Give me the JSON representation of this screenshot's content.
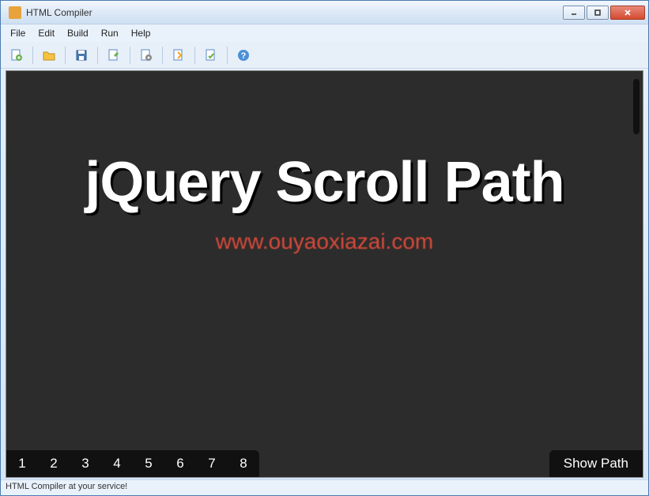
{
  "window": {
    "title": "HTML Compiler"
  },
  "menu": {
    "file": "File",
    "edit": "Edit",
    "build": "Build",
    "run": "Run",
    "help": "Help"
  },
  "toolbar": {
    "icons": [
      "new-file",
      "open-folder",
      "save",
      "edit-doc",
      "settings-doc",
      "export",
      "check-doc",
      "help"
    ]
  },
  "content": {
    "headline": "jQuery Scroll Path",
    "watermark": "www.ouyaoxiazai.com",
    "nav_numbers": [
      "1",
      "2",
      "3",
      "4",
      "5",
      "6",
      "7",
      "8"
    ],
    "show_path_label": "Show Path"
  },
  "statusbar": {
    "text": "HTML Compiler at your service!"
  }
}
